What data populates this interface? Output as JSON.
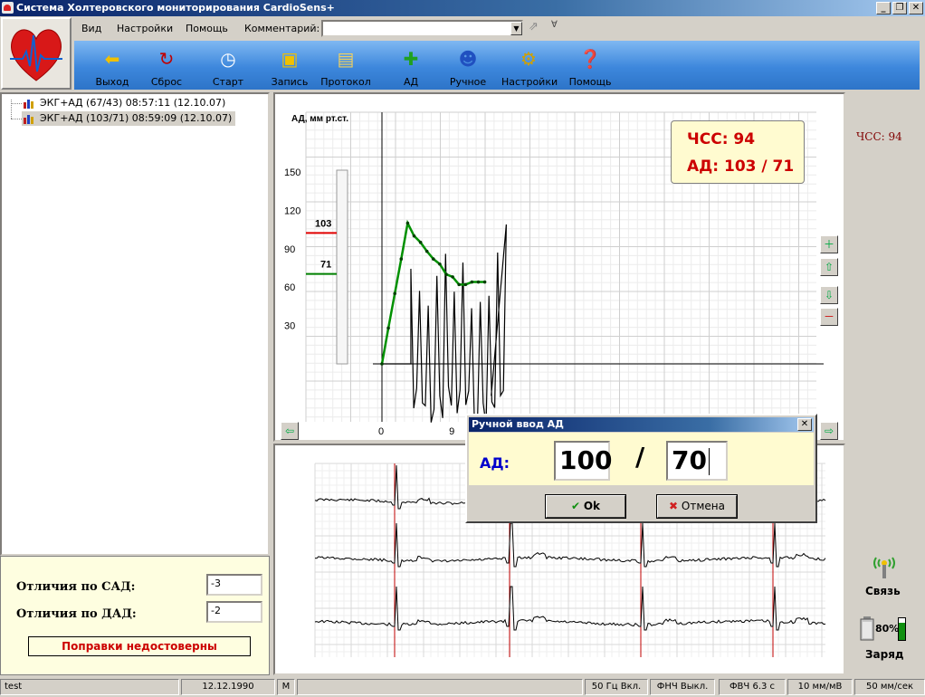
{
  "window": {
    "title": "Система  Холтеровского  мониторирования CardioSens+",
    "min": "_",
    "max": "❐",
    "close": "✕"
  },
  "menu": {
    "items": [
      "Вид",
      "Настройки",
      "Помощь"
    ],
    "comment_label": "Комментарий:",
    "comment_value": ""
  },
  "toolbar": [
    {
      "label": "Выход",
      "icon": "exit-icon",
      "glyph": "⬅",
      "color": "#f0c000"
    },
    {
      "label": "Сброс",
      "icon": "reset-icon",
      "glyph": "↻",
      "color": "#c00000"
    },
    {
      "label": "Старт",
      "icon": "clock-icon",
      "glyph": "◷",
      "color": "#ffffff"
    },
    {
      "label": "Запись",
      "icon": "record-icon",
      "glyph": "▣",
      "color": "#f0c000"
    },
    {
      "label": "Протокол",
      "icon": "protocol-icon",
      "glyph": "▤",
      "color": "#f0d060"
    },
    {
      "label": "АД",
      "icon": "bp-icon",
      "glyph": "✚",
      "color": "#20a020"
    },
    {
      "label": "Ручное",
      "icon": "manual-user-icon",
      "glyph": "☻",
      "color": "#2050c0"
    },
    {
      "label": "Настройки",
      "icon": "settings-icon",
      "glyph": "⚙",
      "color": "#d0a000"
    },
    {
      "label": "Помощь",
      "icon": "help-book-icon",
      "glyph": "❓",
      "color": "#a02080"
    }
  ],
  "tree": [
    {
      "label": "ЭКГ+АД (67/43) 08:57:11 (12.10.07)",
      "selected": false
    },
    {
      "label": "ЭКГ+АД (103/71) 08:59:09 (12.10.07)",
      "selected": true
    }
  ],
  "diffs": {
    "sad_label": "Отличия по САД:",
    "sad_value": "-3",
    "dad_label": "Отличия по ДАД:",
    "dad_value": "-2",
    "warning": "Поправки недостоверны"
  },
  "hr_box": {
    "hr_line": "ЧСС:  94",
    "bp_line": "АД:  103 / 71"
  },
  "right": {
    "hr": "ЧСС: 94",
    "link_label": "Связь",
    "battery_pct": "80%",
    "battery_level": 0.8,
    "charge_label": "Заряд"
  },
  "chart_data": {
    "type": "line",
    "ylabel": "АД, мм рт.ст.",
    "yticks": [
      "150",
      "120",
      "90",
      "60",
      "30"
    ],
    "xticks": [
      "0",
      "9"
    ],
    "ylim": [
      -45,
      180
    ],
    "xlim": [
      0,
      40
    ],
    "markers": {
      "systolic": "103",
      "diastolic": "71",
      "systolic_color": "#e00000",
      "diastolic_color": "#008000"
    },
    "series": [
      {
        "values_x": [
          0,
          1,
          2,
          3,
          4,
          5,
          6,
          7,
          8,
          9,
          10,
          11,
          12,
          13,
          14,
          15,
          16
        ],
        "values_y": [
          0,
          28,
          55,
          82,
          110,
          100,
          95,
          88,
          82,
          78,
          70,
          68,
          62,
          62,
          64,
          64,
          64
        ],
        "color": "#009000"
      }
    ]
  },
  "dialog": {
    "title": "Ручной ввод АД",
    "label": "АД:",
    "sys_value": "100",
    "slash": "/",
    "dia_value": "70",
    "ok": "Ok",
    "cancel": "Отмена",
    "close": "✕"
  },
  "status": [
    "test",
    "12.12.1990",
    "M",
    "50 Гц Вкл.",
    "ФНЧ Выкл.",
    "ФВЧ 6.3 с",
    "10 мм/мВ",
    "50 мм/сек"
  ]
}
